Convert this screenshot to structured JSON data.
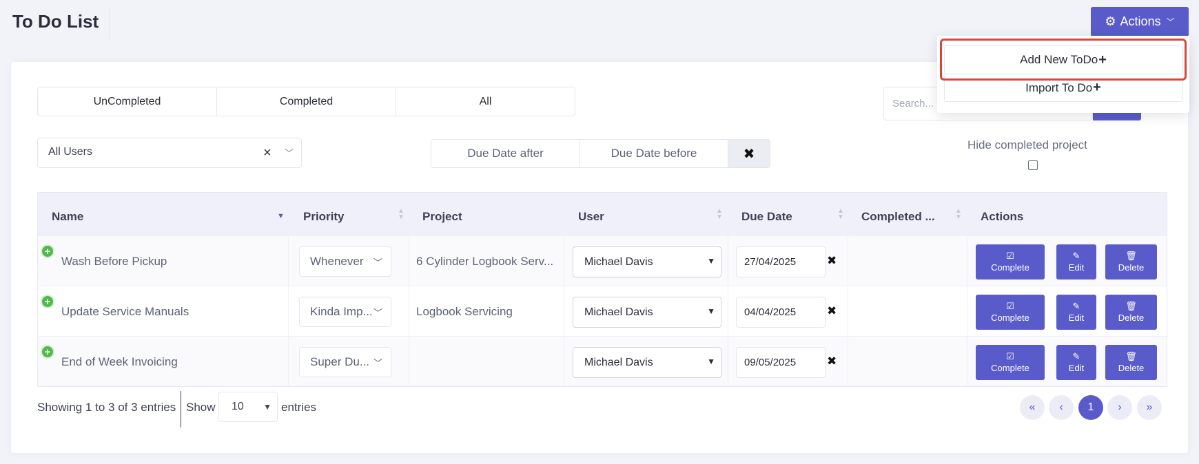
{
  "header": {
    "title": "To Do List",
    "actions_label": "Actions"
  },
  "actions_menu": {
    "items": [
      {
        "label": "Add New ToDo"
      },
      {
        "label": "Import To Do"
      }
    ]
  },
  "filters": {
    "tabs": [
      {
        "label": "UnCompleted"
      },
      {
        "label": "Completed"
      },
      {
        "label": "All"
      }
    ],
    "search_placeholder": "Search...",
    "user_filter_value": "All Users",
    "due_after_label": "Due Date after",
    "due_before_label": "Due Date before",
    "hide_completed_label": "Hide completed project",
    "hide_completed_checked": false
  },
  "table": {
    "columns": [
      "Name",
      "Priority",
      "Project",
      "User",
      "Due Date",
      "Completed ...",
      "Actions"
    ],
    "rows": [
      {
        "name": "Wash Before Pickup",
        "priority": "Whenever",
        "project": "6 Cylinder Logbook Serv...",
        "user": "Michael Davis",
        "due_date": "27/04/2025",
        "completed": ""
      },
      {
        "name": "Update Service Manuals",
        "priority": "Kinda Imp...",
        "project": "Logbook Servicing",
        "user": "Michael Davis",
        "due_date": "04/04/2025",
        "completed": ""
      },
      {
        "name": "End of Week Invoicing",
        "priority": "Super Du...",
        "project": "",
        "user": "Michael Davis",
        "due_date": "09/05/2025",
        "completed": ""
      }
    ],
    "row_actions": {
      "complete": "Complete",
      "edit": "Edit",
      "delete": "Delete"
    }
  },
  "footer": {
    "info": "Showing 1 to 3 of 3 entries",
    "show_label": "Show",
    "page_length": "10",
    "entries_label": "entries",
    "current_page": "1"
  },
  "colors": {
    "accent": "#5a5bcb",
    "highlight": "#d9453a",
    "success": "#50b949"
  }
}
